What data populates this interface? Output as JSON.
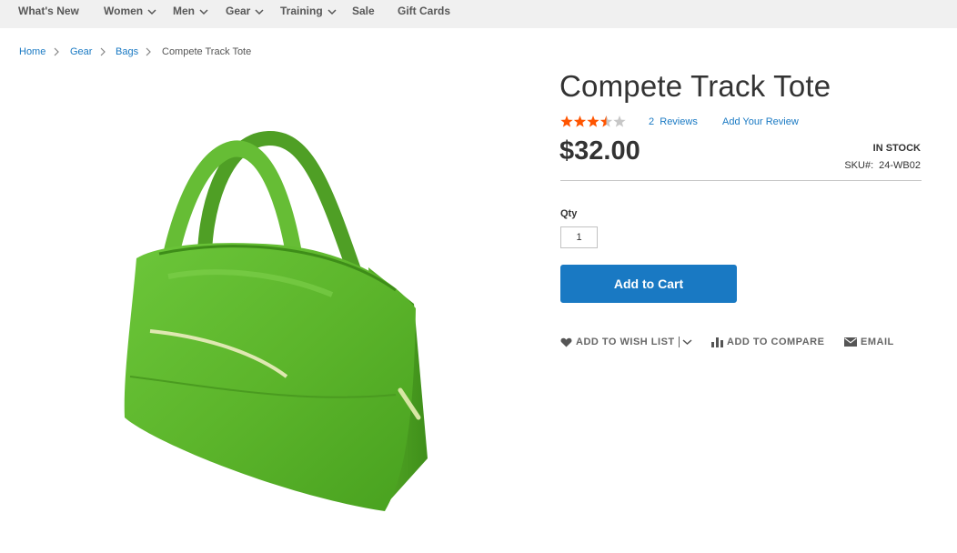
{
  "nav": {
    "items": [
      {
        "label": "What's New",
        "dropdown": false
      },
      {
        "label": "Women",
        "dropdown": true
      },
      {
        "label": "Men",
        "dropdown": true
      },
      {
        "label": "Gear",
        "dropdown": true
      },
      {
        "label": "Training",
        "dropdown": true
      },
      {
        "label": "Sale",
        "dropdown": false
      },
      {
        "label": "Gift Cards",
        "dropdown": false
      }
    ]
  },
  "breadcrumb": {
    "items": [
      "Home",
      "Gear",
      "Bags"
    ],
    "current": "Compete Track Tote"
  },
  "product": {
    "title": "Compete Track Tote",
    "rating": {
      "value": 3.5,
      "max": 5
    },
    "reviews_count": "2",
    "reviews_label": "Reviews",
    "add_review_label": "Add Your Review",
    "price": "$32.00",
    "stock": "In stock",
    "sku_label": "SKU#:",
    "sku_value": "24-WB02",
    "image_icon": "green-tote-bag-image"
  },
  "purchase": {
    "qty_label": "Qty",
    "qty_value": "1",
    "add_to_cart_label": "Add to Cart"
  },
  "actions": {
    "wishlist_label": "Add to Wish List",
    "compare_label": "Add to Compare",
    "email_label": "Email"
  },
  "colors": {
    "nav_background": "#f0f0f0",
    "link": "#1979c3",
    "button": "#1979c3",
    "star_filled": "#ff5501",
    "star_empty": "#c7c7c7",
    "bag_green": "#5fb82e"
  }
}
